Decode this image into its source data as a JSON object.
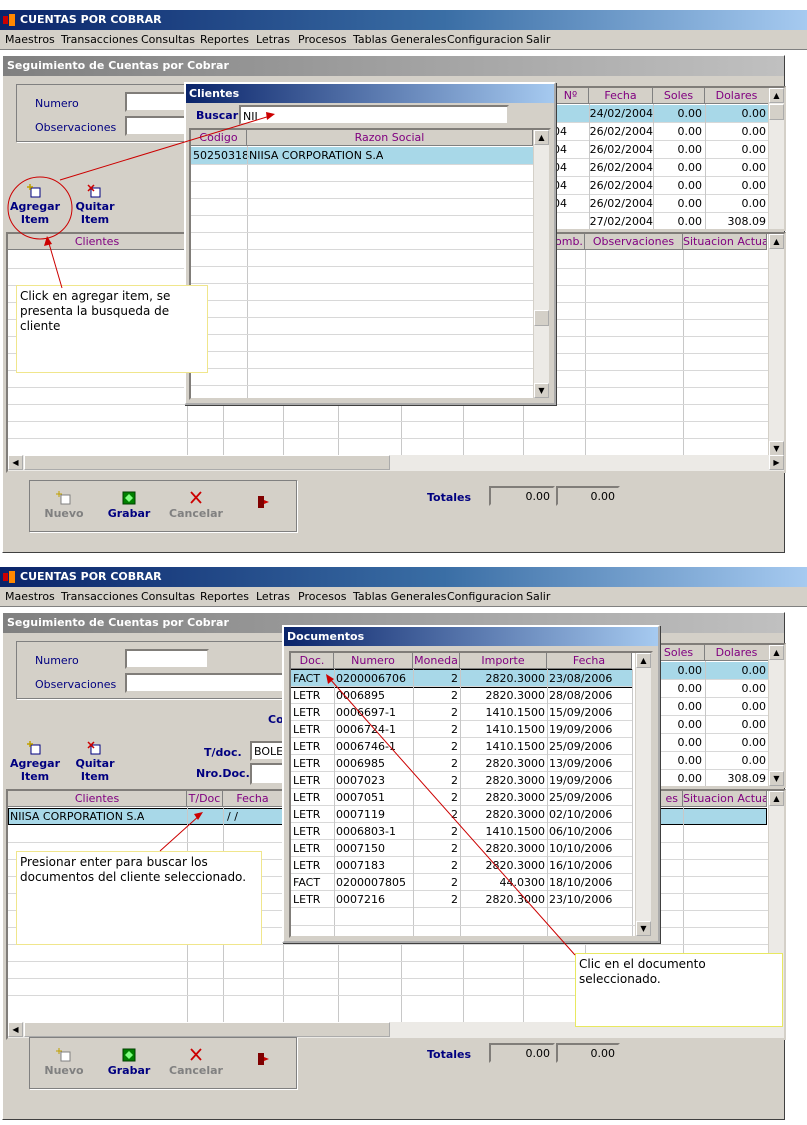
{
  "app_title": "CUENTAS POR COBRAR",
  "menu": [
    "Maestros",
    "Transacciones",
    "Consultas",
    "Reportes",
    "Letras",
    "Procesos",
    "Tablas Generales",
    "Configuracion",
    "Salir"
  ],
  "form_title": "Seguimiento de Cuentas por Cobrar",
  "labels": {
    "numero": "Numero",
    "observaciones": "Observaciones",
    "tdoc": "T/doc.",
    "nrodoc": "Nro.Doc.",
    "tdoc_value": "BOLE",
    "co_partial": "Co",
    "totales": "Totales",
    "total_soles": "0.00",
    "total_dolares": "0.00"
  },
  "item_buttons": {
    "agregar": "Agregar\nItem",
    "quitar": "Quitar\nItem"
  },
  "toolbar": {
    "nuevo": "Nuevo",
    "grabar": "Grabar",
    "cancelar": "Cancelar"
  },
  "top_grid": {
    "headers": [
      "Nº",
      "Fecha",
      "Soles",
      "Dolares"
    ],
    "rows": [
      [
        "",
        "24/02/2004",
        "0.00",
        "0.00"
      ],
      [
        "04",
        "26/02/2004",
        "0.00",
        "0.00"
      ],
      [
        "04",
        "26/02/2004",
        "0.00",
        "0.00"
      ],
      [
        "04",
        "26/02/2004",
        "0.00",
        "0.00"
      ],
      [
        "04",
        "26/02/2004",
        "0.00",
        "0.00"
      ],
      [
        "04",
        "26/02/2004",
        "0.00",
        "0.00"
      ],
      [
        "",
        "27/02/2004",
        "0.00",
        "308.09"
      ]
    ]
  },
  "top_grid2": {
    "headers": [
      "Soles",
      "Dolares"
    ],
    "rows": [
      [
        "0.00",
        "0.00"
      ],
      [
        "0.00",
        "0.00"
      ],
      [
        "0.00",
        "0.00"
      ],
      [
        "0.00",
        "0.00"
      ],
      [
        "0.00",
        "0.00"
      ],
      [
        "0.00",
        "0.00"
      ],
      [
        "0.00",
        "308.09"
      ]
    ]
  },
  "detail_grid": {
    "headers_1": [
      "Clientes",
      "omb.",
      "Observaciones",
      "Situacion  Actual"
    ],
    "headers_2": [
      "Clientes",
      "T/Doc",
      "Fecha",
      "es",
      "Situacion  Actual"
    ],
    "row_2": {
      "cliente": "NIISA CORPORATION S.A",
      "fecha": "/ /"
    }
  },
  "clientes_popup": {
    "title": "Clientes",
    "search_label": "Buscar",
    "search_value": "NII",
    "headers": [
      "Codigo",
      "Razon Social"
    ],
    "rows": [
      [
        "50250318",
        "NIISA CORPORATION S.A"
      ]
    ]
  },
  "documentos_popup": {
    "title": "Documentos",
    "headers": [
      "Doc.",
      "Numero",
      "Moneda",
      "Importe",
      "Fecha"
    ],
    "rows": [
      [
        "FACT",
        "0200006706",
        "2",
        "2820.3000",
        "23/08/2006"
      ],
      [
        "LETR",
        "0006895",
        "2",
        "2820.3000",
        "28/08/2006"
      ],
      [
        "LETR",
        "0006697-1",
        "2",
        "1410.1500",
        "15/09/2006"
      ],
      [
        "LETR",
        "0006724-1",
        "2",
        "1410.1500",
        "19/09/2006"
      ],
      [
        "LETR",
        "0006746-1",
        "2",
        "1410.1500",
        "25/09/2006"
      ],
      [
        "LETR",
        "0006985",
        "2",
        "2820.3000",
        "13/09/2006"
      ],
      [
        "LETR",
        "0007023",
        "2",
        "2820.3000",
        "19/09/2006"
      ],
      [
        "LETR",
        "0007051",
        "2",
        "2820.3000",
        "25/09/2006"
      ],
      [
        "LETR",
        "0007119",
        "2",
        "2820.3000",
        "02/10/2006"
      ],
      [
        "LETR",
        "0006803-1",
        "2",
        "1410.1500",
        "06/10/2006"
      ],
      [
        "LETR",
        "0007150",
        "2",
        "2820.3000",
        "10/10/2006"
      ],
      [
        "LETR",
        "0007183",
        "2",
        "2820.3000",
        "16/10/2006"
      ],
      [
        "FACT",
        "0200007805",
        "2",
        "44.0300",
        "18/10/2006"
      ],
      [
        "LETR",
        "0007216",
        "2",
        "2820.3000",
        "23/10/2006"
      ]
    ]
  },
  "notes": {
    "n1": "Click en agregar item, se presenta la busqueda de cliente",
    "n2": "Presionar enter para buscar los documentos del cliente seleccionado.",
    "n3": "Clic en el documento seleccionado."
  },
  "colors": {
    "title_dark": "#0a246a",
    "title_light": "#a6caf0",
    "header_text": "#800080",
    "label_blue": "#000080",
    "selection": "#a8d8e8",
    "annotation": "#cc0000"
  }
}
